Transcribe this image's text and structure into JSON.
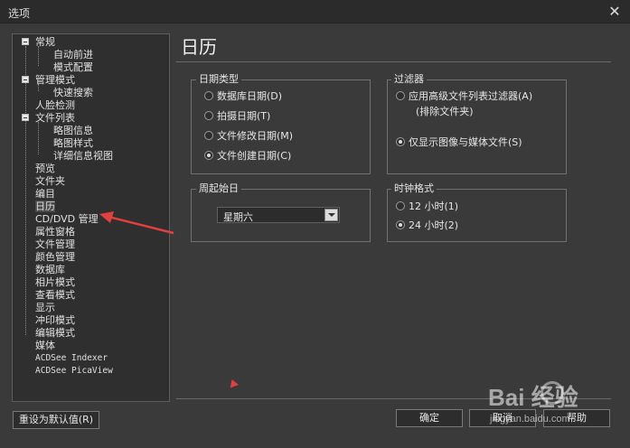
{
  "window": {
    "title": "选项",
    "close_glyph": "✕"
  },
  "tree": {
    "items": [
      {
        "label": "常规",
        "level": 0,
        "expanded": true
      },
      {
        "label": "自动前进",
        "level": 2
      },
      {
        "label": "模式配置",
        "level": 2
      },
      {
        "label": "管理模式",
        "level": 0,
        "expanded": true
      },
      {
        "label": "快速搜索",
        "level": 2
      },
      {
        "label": "人脸检测",
        "level": 1
      },
      {
        "label": "文件列表",
        "level": 0,
        "expanded": true
      },
      {
        "label": "略图信息",
        "level": 2
      },
      {
        "label": "略图样式",
        "level": 2
      },
      {
        "label": "详细信息视图",
        "level": 2
      },
      {
        "label": "预览",
        "level": 1
      },
      {
        "label": "文件夹",
        "level": 1
      },
      {
        "label": "编目",
        "level": 1
      },
      {
        "label": "日历",
        "level": 1,
        "selected": true
      },
      {
        "label": "CD/DVD 管理",
        "level": 1
      },
      {
        "label": "属性窗格",
        "level": 1
      },
      {
        "label": "文件管理",
        "level": 1
      },
      {
        "label": "颜色管理",
        "level": 1
      },
      {
        "label": "数据库",
        "level": 1
      },
      {
        "label": "相片模式",
        "level": 1
      },
      {
        "label": "查看模式",
        "level": 1
      },
      {
        "label": "显示",
        "level": 1
      },
      {
        "label": "冲印模式",
        "level": 1
      },
      {
        "label": "编辑模式",
        "level": 1
      },
      {
        "label": "媒体",
        "level": 1
      },
      {
        "label": "ACDSee Indexer",
        "level": 1,
        "mono": true
      },
      {
        "label": "ACDSee PicaView",
        "level": 1,
        "mono": true
      }
    ]
  },
  "page": {
    "heading": "日历"
  },
  "date_type": {
    "title": "日期类型",
    "options": [
      {
        "label": "数据库日期(D)",
        "checked": false
      },
      {
        "label": "拍摄日期(T)",
        "checked": false
      },
      {
        "label": "文件修改日期(M)",
        "checked": false
      },
      {
        "label": "文件创建日期(C)",
        "checked": true
      }
    ]
  },
  "filter": {
    "title": "过滤器",
    "options": [
      {
        "label": "应用高级文件列表过滤器(A)",
        "sub": "(排除文件夹)",
        "checked": false
      },
      {
        "label": "仅显示图像与媒体文件(S)",
        "checked": true
      }
    ]
  },
  "week_start": {
    "title": "周起始日",
    "selected": "星期六"
  },
  "clock": {
    "title": "时钟格式",
    "options": [
      {
        "label": "12 小时(1)",
        "checked": false
      },
      {
        "label": "24 小时(2)",
        "checked": true
      }
    ]
  },
  "buttons": {
    "reset": "重设为默认值(R)",
    "ok": "确定",
    "cancel": "取消",
    "help": "帮助"
  },
  "watermark": {
    "brand": "Bai 经验",
    "url": "jingyan.baidu.com"
  },
  "colors": {
    "annotation_arrow": "#e0403f",
    "background": "#3a3a3a"
  },
  "icons": {
    "expander": "minus-box-icon",
    "close": "close-icon"
  }
}
